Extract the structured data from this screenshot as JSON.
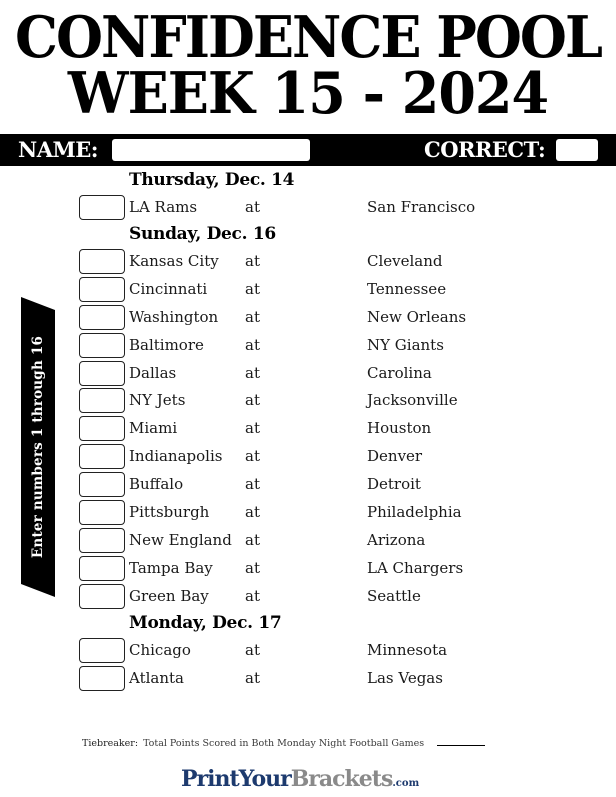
{
  "title": {
    "line1": "CONFIDENCE POOL",
    "line2": "WEEK 15 - 2024"
  },
  "header_bar": {
    "name_label": "NAME:",
    "name_value": "",
    "correct_label": "CORRECT:",
    "correct_value": ""
  },
  "side_banner": "Enter numbers 1 through 16",
  "days": [
    {
      "label": "Thursday, Dec. 14",
      "games": [
        {
          "away": "LA Rams",
          "at": "at",
          "home": "San Francisco",
          "points": ""
        }
      ]
    },
    {
      "label": "Sunday, Dec. 16",
      "games": [
        {
          "away": "Kansas City",
          "at": "at",
          "home": "Cleveland",
          "points": ""
        },
        {
          "away": "Cincinnati",
          "at": "at",
          "home": "Tennessee",
          "points": ""
        },
        {
          "away": "Washington",
          "at": "at",
          "home": "New Orleans",
          "points": ""
        },
        {
          "away": "Baltimore",
          "at": "at",
          "home": "NY Giants",
          "points": ""
        },
        {
          "away": "Dallas",
          "at": "at",
          "home": "Carolina",
          "points": ""
        },
        {
          "away": "NY Jets",
          "at": "at",
          "home": "Jacksonville",
          "points": ""
        },
        {
          "away": "Miami",
          "at": "at",
          "home": "Houston",
          "points": ""
        },
        {
          "away": "Indianapolis",
          "at": "at",
          "home": "Denver",
          "points": ""
        },
        {
          "away": "Buffalo",
          "at": "at",
          "home": "Detroit",
          "points": ""
        },
        {
          "away": "Pittsburgh",
          "at": "at",
          "home": "Philadelphia",
          "points": ""
        },
        {
          "away": "New England",
          "at": "at",
          "home": "Arizona",
          "points": ""
        },
        {
          "away": "Tampa Bay",
          "at": "at",
          "home": "LA Chargers",
          "points": ""
        },
        {
          "away": "Green Bay",
          "at": "at",
          "home": "Seattle",
          "points": ""
        }
      ]
    },
    {
      "label": "Monday, Dec. 17",
      "games": [
        {
          "away": "Chicago",
          "at": "at",
          "home": "Minnesota",
          "points": ""
        },
        {
          "away": "Atlanta",
          "at": "at",
          "home": "Las Vegas",
          "points": ""
        }
      ]
    }
  ],
  "tiebreaker": {
    "label": "Tiebreaker:",
    "description": "Total Points Scored in Both Monday Night Football Games",
    "value": ""
  },
  "logo": {
    "part1": "PrintYour",
    "part2": "Brackets",
    "part3": ".com",
    "color_primary": "#1d3a6e",
    "color_secondary": "#8a8a8a"
  }
}
